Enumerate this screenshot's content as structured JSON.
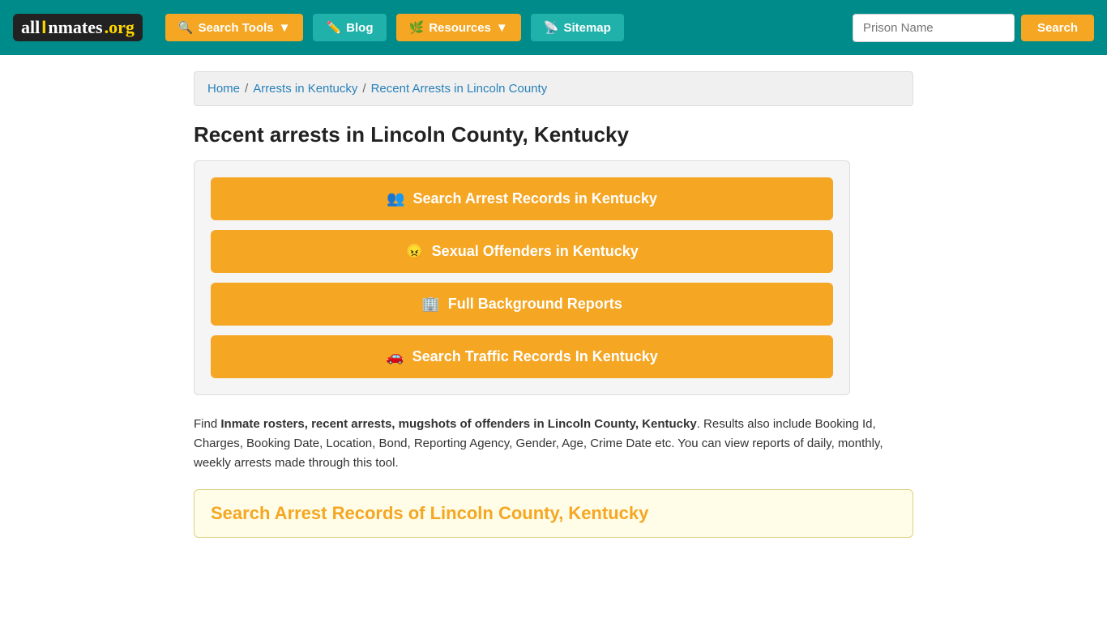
{
  "header": {
    "logo": {
      "text_all": "all",
      "text_i": "I",
      "text_nmates": "nmates",
      "text_org": ".org"
    },
    "nav": [
      {
        "id": "search-tools",
        "label": "Search Tools",
        "icon": "🔍",
        "has_dropdown": true
      },
      {
        "id": "blog",
        "label": "Blog",
        "icon": "✏️",
        "has_dropdown": false
      },
      {
        "id": "resources",
        "label": "Resources",
        "icon": "🌿",
        "has_dropdown": true
      },
      {
        "id": "sitemap",
        "label": "Sitemap",
        "icon": "📡",
        "has_dropdown": false
      }
    ],
    "search_placeholder": "Prison Name",
    "search_button_label": "Search"
  },
  "breadcrumb": {
    "home": "Home",
    "arrests_kentucky": "Arrests in Kentucky",
    "current": "Recent Arrests in Lincoln County"
  },
  "page": {
    "title": "Recent arrests in Lincoln County, Kentucky",
    "buttons": [
      {
        "id": "search-arrest",
        "icon": "👥",
        "label": "Search Arrest Records in Kentucky"
      },
      {
        "id": "sexual-offenders",
        "icon": "😠",
        "label": "Sexual Offenders in Kentucky"
      },
      {
        "id": "background-reports",
        "icon": "🏢",
        "label": "Full Background Reports"
      },
      {
        "id": "traffic-records",
        "icon": "🚗",
        "label": "Search Traffic Records In Kentucky"
      }
    ],
    "description_prefix": "Find ",
    "description_bold": "Inmate rosters, recent arrests, mugshots of offenders in Lincoln County, Kentucky",
    "description_suffix": ". Results also include Booking Id, Charges, Booking Date, Location, Bond, Reporting Agency, Gender, Age, Crime Date etc. You can view reports of daily, monthly, weekly arrests made through this tool.",
    "search_section_title": "Search Arrest Records of Lincoln County, Kentucky"
  }
}
